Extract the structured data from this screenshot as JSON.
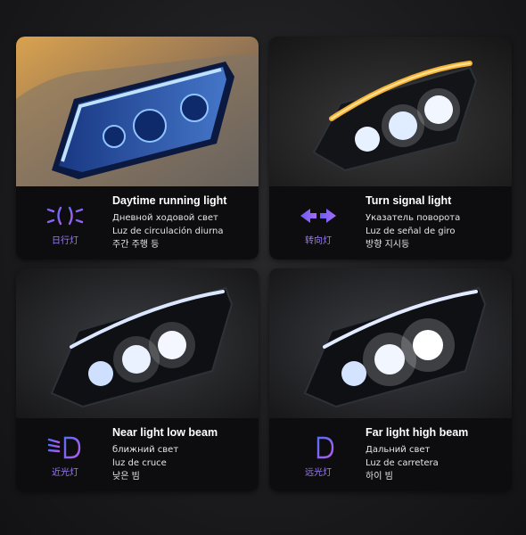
{
  "panels": [
    {
      "title": "Daytime running light",
      "lines": [
        "Дневной ходовой свет",
        "Luz de circulación diurna",
        "주간 주행 등"
      ],
      "icon_label": "日行灯",
      "icon": "daytime-running-light-icon",
      "accent": "#7b5cf0"
    },
    {
      "title": "Turn signal light",
      "lines": [
        "Указатель поворота",
        "Luz de señal de giro",
        "방향 지시등"
      ],
      "icon_label": "转向灯",
      "icon": "turn-signal-arrows-icon",
      "accent": "#7b5cf0"
    },
    {
      "title": "Near light low beam",
      "lines": [
        "ближний свет",
        "luz de cruce",
        "낮은 빔"
      ],
      "icon_label": "近光灯",
      "icon": "low-beam-icon",
      "accent": "#7b5cf0"
    },
    {
      "title": "Far light high beam",
      "lines": [
        "Дальний свет",
        "Luz de carretera",
        "하이 빔"
      ],
      "icon_label": "远光灯",
      "icon": "high-beam-icon",
      "accent": "#7b5cf0"
    }
  ]
}
